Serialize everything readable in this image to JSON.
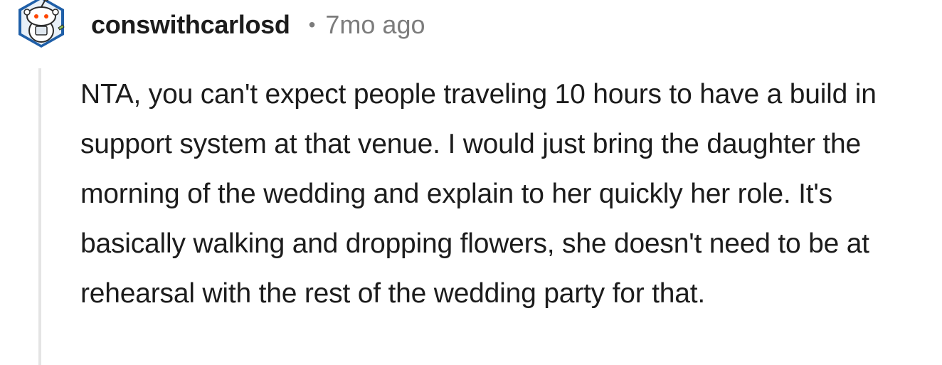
{
  "comment": {
    "username": "conswithcarlosd",
    "separator": "•",
    "timestamp": "7mo ago",
    "avatar_icon": "reddit-snoo-avatar-icon",
    "body": "NTA, you can't expect people traveling 10 hours to have a build in support system at that venue. I would just bring the daughter the morning of the wedding and explain to her quickly her role. It's basically walking and dropping flowers, she doesn't need to be at rehearsal with the rest of the wedding party for that."
  },
  "colors": {
    "username": "#1c1c1c",
    "meta": "#7c7c7c",
    "thread_line": "#e4e4e4",
    "avatar_ring": "#3b7fd1",
    "avatar_accent": "#ff4500"
  }
}
